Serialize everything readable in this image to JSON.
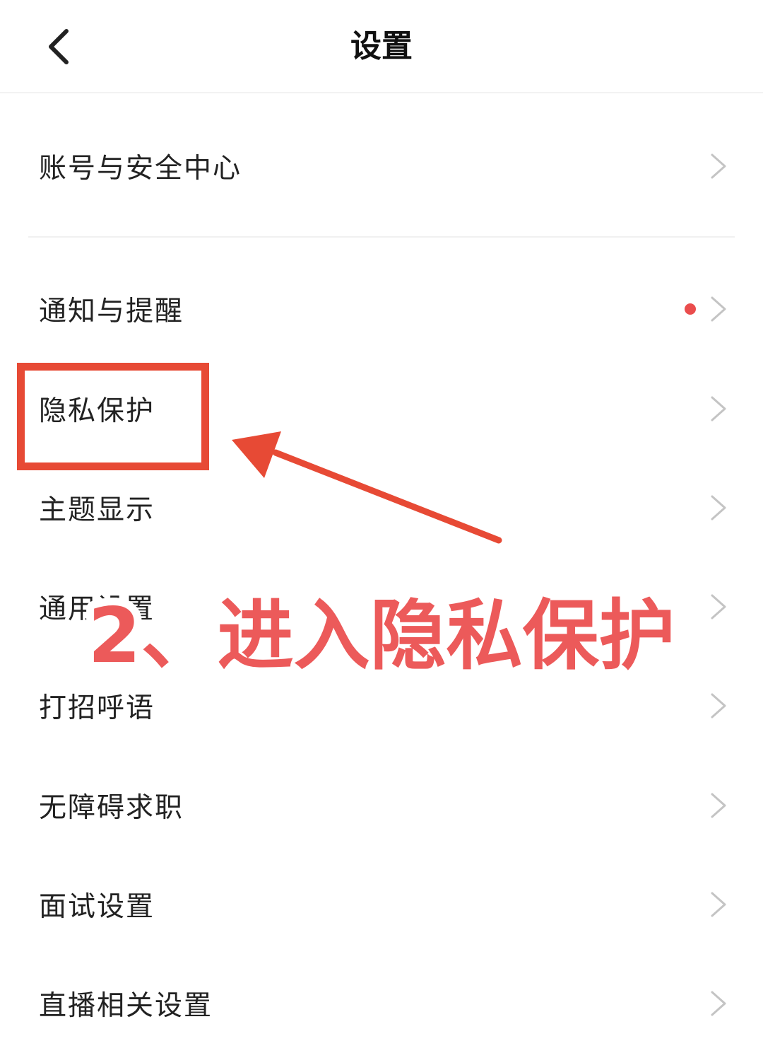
{
  "header": {
    "title": "设置",
    "back_icon": "chevron-left-icon"
  },
  "menu": {
    "items": [
      {
        "label": "账号与安全中心",
        "badge": false
      },
      {
        "label": "通知与提醒",
        "badge": true
      },
      {
        "label": "隐私保护",
        "badge": false
      },
      {
        "label": "主题显示",
        "badge": false
      },
      {
        "label": "通用设置",
        "badge": false
      },
      {
        "label": "打招呼语",
        "badge": false
      },
      {
        "label": "无障碍求职",
        "badge": false
      },
      {
        "label": "面试设置",
        "badge": false
      },
      {
        "label": "直播相关设置",
        "badge": false
      }
    ],
    "chevron_icon": "chevron-right-icon",
    "badge_color": "#ea4d4d"
  },
  "annotation": {
    "caption": "2、进入隐私保护",
    "accent_color": "#e74a35",
    "caption_color": "#ec5a5a"
  }
}
